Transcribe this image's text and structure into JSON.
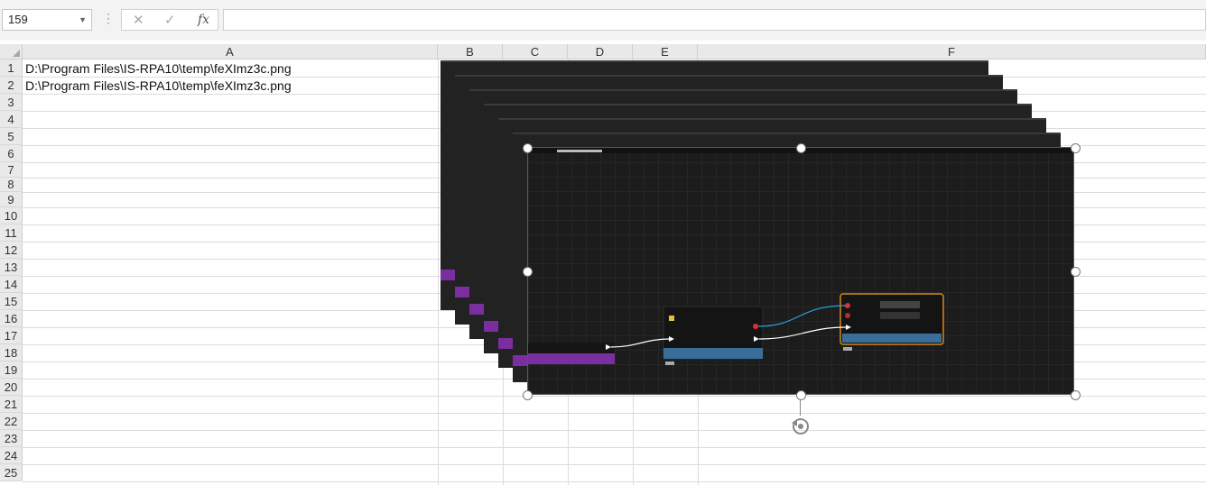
{
  "formula_bar": {
    "name_box": "159",
    "cancel_icon": "close-icon",
    "enter_icon": "check-icon",
    "fx_label": "fx",
    "formula": ""
  },
  "columns": [
    "A",
    "B",
    "C",
    "D",
    "E",
    "F"
  ],
  "rows": [
    "1",
    "2",
    "3",
    "4",
    "5",
    "6",
    "7",
    "8",
    "9",
    "10",
    "11",
    "12",
    "13",
    "14",
    "15",
    "16",
    "17",
    "18",
    "19",
    "20",
    "21",
    "22",
    "23",
    "24",
    "25"
  ],
  "cells": {
    "A1": "D:\\Program Files\\IS-RPA10\\temp\\feXImz3c.png",
    "A2": "D:\\Program Files\\IS-RPA10\\temp\\feXImz3c.png"
  },
  "colors": {
    "header_bg": "#e9e9e9",
    "grid_line": "#dcdcdc",
    "image_bg": "#1c1c1c",
    "node_accent_blue": "#3a6e9a",
    "node_border_orange": "#d48a1a",
    "purple_node": "#7a2ea0",
    "wire_blue": "#29a0e0"
  }
}
